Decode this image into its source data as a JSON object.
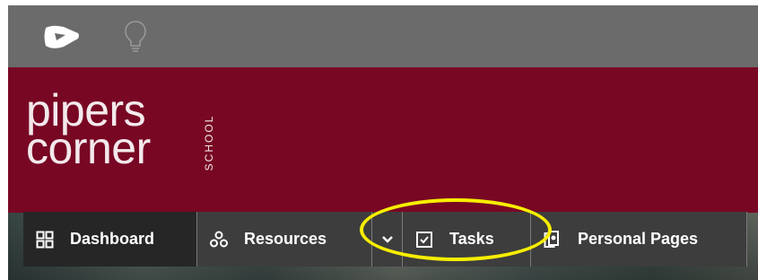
{
  "topbar": {
    "logo_icon": "school-logo-icon",
    "idea_icon": "lightbulb-icon"
  },
  "brand": {
    "line1": "pipers",
    "line2": "corner",
    "school": "SCHOOL"
  },
  "nav": {
    "items": [
      {
        "label": "Dashboard",
        "icon": "grid-icon"
      },
      {
        "label": "Resources",
        "icon": "resources-icon",
        "dropdown_icon": "chevron-down-icon"
      },
      {
        "label": "Tasks",
        "icon": "checkbox-icon"
      },
      {
        "label": "Personal Pages",
        "icon": "personal-pages-icon"
      }
    ]
  },
  "colors": {
    "topbar": "#6b6b6b",
    "header": "#780724",
    "nav": "#3d3d3d",
    "nav_active": "#262626",
    "highlight": "#f7ee00"
  }
}
